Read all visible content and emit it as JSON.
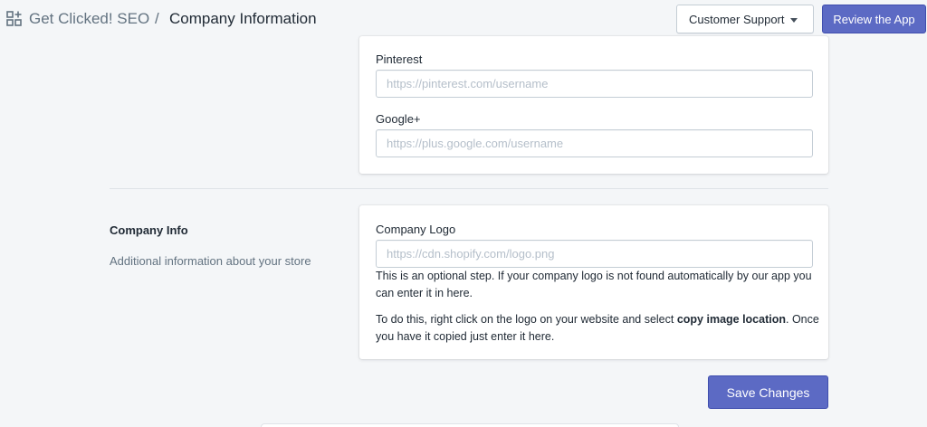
{
  "header": {
    "app_name": "Get Clicked! SEO",
    "separator": "/",
    "page_title": "Company Information",
    "support_label": "Customer Support",
    "review_label": "Review the App"
  },
  "social": {
    "pinterest": {
      "label": "Pinterest",
      "placeholder": "https://pinterest.com/username",
      "value": ""
    },
    "google": {
      "label": "Google+",
      "placeholder": "https://plus.google.com/username",
      "value": ""
    }
  },
  "company_info": {
    "title": "Company Info",
    "description": "Additional information about your store",
    "logo": {
      "label": "Company Logo",
      "placeholder": "https://cdn.shopify.com/logo.png",
      "value": ""
    },
    "help_1": "This is an optional step. If your company logo is not found automatically by our app you can enter it in here.",
    "help_2_before": "To do this, right click on the logo on your website and select ",
    "help_2_bold": "copy image location",
    "help_2_after": ". Once you have it copied just enter it here."
  },
  "actions": {
    "save_label": "Save Changes"
  },
  "colors": {
    "primary": "#5c6ac4",
    "background": "#f4f6f8",
    "border": "#c4cdd5"
  }
}
